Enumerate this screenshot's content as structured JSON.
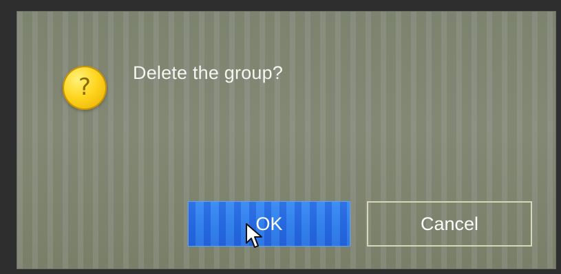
{
  "dialog": {
    "icon": "question-icon",
    "icon_glyph": "?",
    "message": "Delete the group?",
    "ok_label": "OK",
    "cancel_label": "Cancel"
  },
  "colors": {
    "ok_button": "#2f7fe9",
    "icon_yellow": "#ffd51f",
    "text": "#f5f5f2"
  }
}
